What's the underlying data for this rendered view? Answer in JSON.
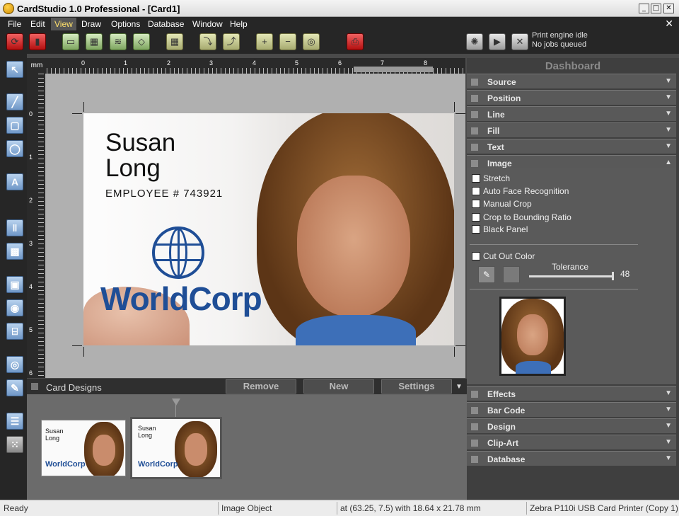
{
  "window": {
    "title": "CardStudio 1.0 Professional - [Card1]",
    "min": "_",
    "max": "□",
    "close": "✕"
  },
  "menu": [
    "File",
    "Edit",
    "View",
    "Draw",
    "Options",
    "Database",
    "Window",
    "Help"
  ],
  "menu_active": "View",
  "menu_close": "✕",
  "engine": {
    "line1": "Print engine idle",
    "line2": "No jobs queued"
  },
  "ruler": {
    "unit": "mm",
    "top": [
      "0",
      "1",
      "2",
      "3",
      "4",
      "5",
      "6",
      "7",
      "8"
    ],
    "left": [
      "0",
      "1",
      "2",
      "3",
      "4",
      "5",
      "6"
    ]
  },
  "card": {
    "name_line1": "Susan",
    "name_line2": "Long",
    "employee": "EMPLOYEE # 743921",
    "logo": "WorldCorp"
  },
  "designs": {
    "title": "Card Designs",
    "remove": "Remove",
    "new": "New",
    "settings": "Settings"
  },
  "thumbs": [
    {
      "name1": "Susan",
      "name2": "Long",
      "logo": "WorldCorp"
    },
    {
      "name1": "Susan",
      "name2": "Long",
      "logo": "WorldCorp"
    }
  ],
  "dashboard": {
    "title": "Dashboard",
    "sections_top": [
      "Source",
      "Position",
      "Line",
      "Fill",
      "Text",
      "Image"
    ],
    "sections_bottom": [
      "Effects",
      "Bar Code",
      "Design",
      "Clip-Art",
      "Database"
    ],
    "image_options": [
      "Stretch",
      "Auto Face Recognition",
      "Manual Crop",
      "Crop to Bounding Ratio",
      "Black Panel"
    ],
    "cutout": "Cut Out Color",
    "tolerance_label": "Tolerance",
    "tolerance_value": "48"
  },
  "status": {
    "ready": "Ready",
    "object": "Image Object",
    "position": "at (63.25, 7.5) with 18.64 x 21.78 mm",
    "printer": "Zebra P110i USB Card Printer (Copy 1)"
  },
  "colors": {
    "accent": "#1f4e96",
    "dark": "#262626",
    "panel": "#595959"
  }
}
